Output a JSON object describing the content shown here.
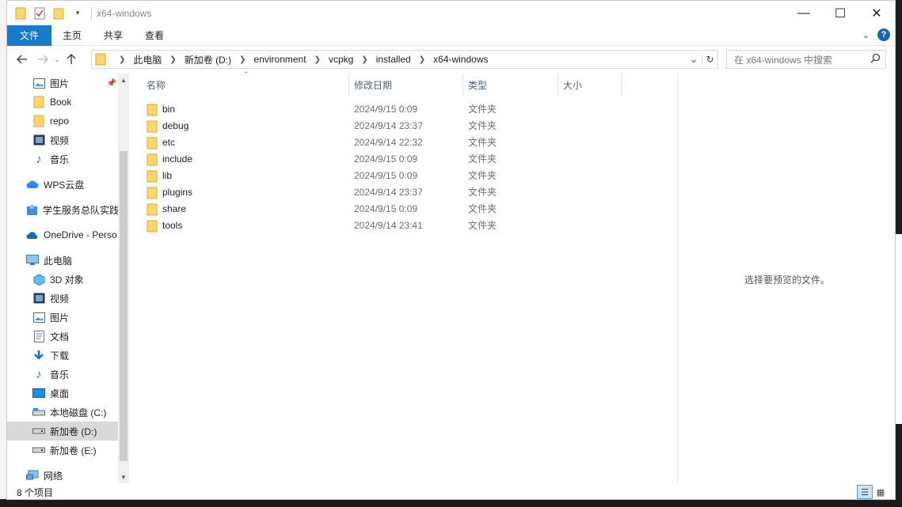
{
  "window": {
    "title": "x64-windows"
  },
  "window_controls": {
    "minimize": "—",
    "maximize": "☐",
    "close": "✕"
  },
  "ribbon": {
    "tabs": [
      "文件",
      "主页",
      "共享",
      "查看"
    ],
    "expand_icon": "chevron-down-icon",
    "help": "?"
  },
  "address": {
    "crumbs": [
      "此电脑",
      "新加卷 (D:)",
      "environment",
      "vcpkg",
      "installed",
      "x64-windows"
    ]
  },
  "search": {
    "placeholder": "在 x64-windows 中搜索"
  },
  "sidebar": {
    "items": [
      {
        "label": "图片",
        "icon": "pictures-icon",
        "pinned": true
      },
      {
        "label": "Book",
        "icon": "folder-icon"
      },
      {
        "label": "repo",
        "icon": "folder-icon"
      },
      {
        "label": "视频",
        "icon": "video-icon"
      },
      {
        "label": "音乐",
        "icon": "music-icon"
      },
      {
        "label": "WPS云盘",
        "icon": "cloud-icon"
      },
      {
        "label": "学生服务总队实践",
        "icon": "shared-folder-icon"
      },
      {
        "label": "OneDrive - Perso",
        "icon": "onedrive-icon"
      },
      {
        "label": "此电脑",
        "icon": "computer-icon"
      },
      {
        "label": "3D 对象",
        "icon": "3d-objects-icon"
      },
      {
        "label": "视频",
        "icon": "video-icon"
      },
      {
        "label": "图片",
        "icon": "pictures-icon"
      },
      {
        "label": "文档",
        "icon": "documents-icon"
      },
      {
        "label": "下载",
        "icon": "download-icon"
      },
      {
        "label": "音乐",
        "icon": "music-icon"
      },
      {
        "label": "桌面",
        "icon": "desktop-icon"
      },
      {
        "label": "本地磁盘 (C:)",
        "icon": "drive-icon"
      },
      {
        "label": "新加卷 (D:)",
        "icon": "drive-icon",
        "selected": true
      },
      {
        "label": "新加卷 (E:)",
        "icon": "drive-icon"
      },
      {
        "label": "网络",
        "icon": "network-icon"
      }
    ]
  },
  "columns": {
    "name": "名称",
    "date": "修改日期",
    "type": "类型",
    "size": "大小"
  },
  "files": [
    {
      "name": "bin",
      "date": "2024/9/15 0:09",
      "type": "文件夹"
    },
    {
      "name": "debug",
      "date": "2024/9/14 23:37",
      "type": "文件夹"
    },
    {
      "name": "etc",
      "date": "2024/9/14 22:32",
      "type": "文件夹"
    },
    {
      "name": "include",
      "date": "2024/9/15 0:09",
      "type": "文件夹"
    },
    {
      "name": "lib",
      "date": "2024/9/15 0:09",
      "type": "文件夹"
    },
    {
      "name": "plugins",
      "date": "2024/9/14 23:37",
      "type": "文件夹"
    },
    {
      "name": "share",
      "date": "2024/9/15 0:09",
      "type": "文件夹"
    },
    {
      "name": "tools",
      "date": "2024/9/14 23:41",
      "type": "文件夹"
    }
  ],
  "preview": {
    "message": "选择要预览的文件。"
  },
  "status": {
    "count": "8 个项目"
  },
  "colors": {
    "accent": "#1979ca",
    "folder": "#ffd769",
    "selected": "#d9d9d9"
  }
}
